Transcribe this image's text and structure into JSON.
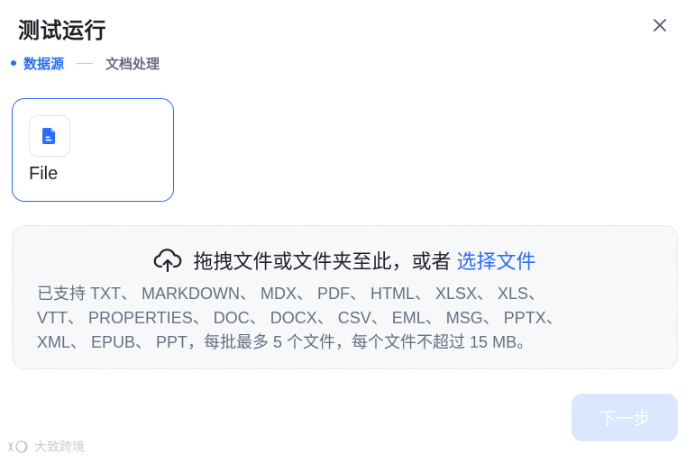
{
  "dialog": {
    "title": "测试运行"
  },
  "steps": [
    {
      "label": "数据源",
      "active": true
    },
    {
      "label": "文档处理",
      "active": false
    }
  ],
  "source": {
    "label": "File",
    "icon": "file-document-icon"
  },
  "dropzone": {
    "prompt": "拖拽文件或文件夹至此，或者",
    "link": "选择文件",
    "hint_lines": [
      "已支持 TXT、 MARKDOWN、 MDX、 PDF、 HTML、 XLSX、 XLS、",
      "VTT、 PROPERTIES、 DOC、 DOCX、 CSV、 EML、 MSG、 PPTX、",
      "XML、 EPUB、 PPT，每批最多 5 个文件，每个文件不超过 15 MB。"
    ]
  },
  "footer": {
    "next_label": "下一步"
  },
  "watermark": {
    "text": "大致跨境"
  },
  "colors": {
    "accent": "#296dff",
    "accent_disabled": "#dbe7ff",
    "muted_text": "#676f83"
  }
}
